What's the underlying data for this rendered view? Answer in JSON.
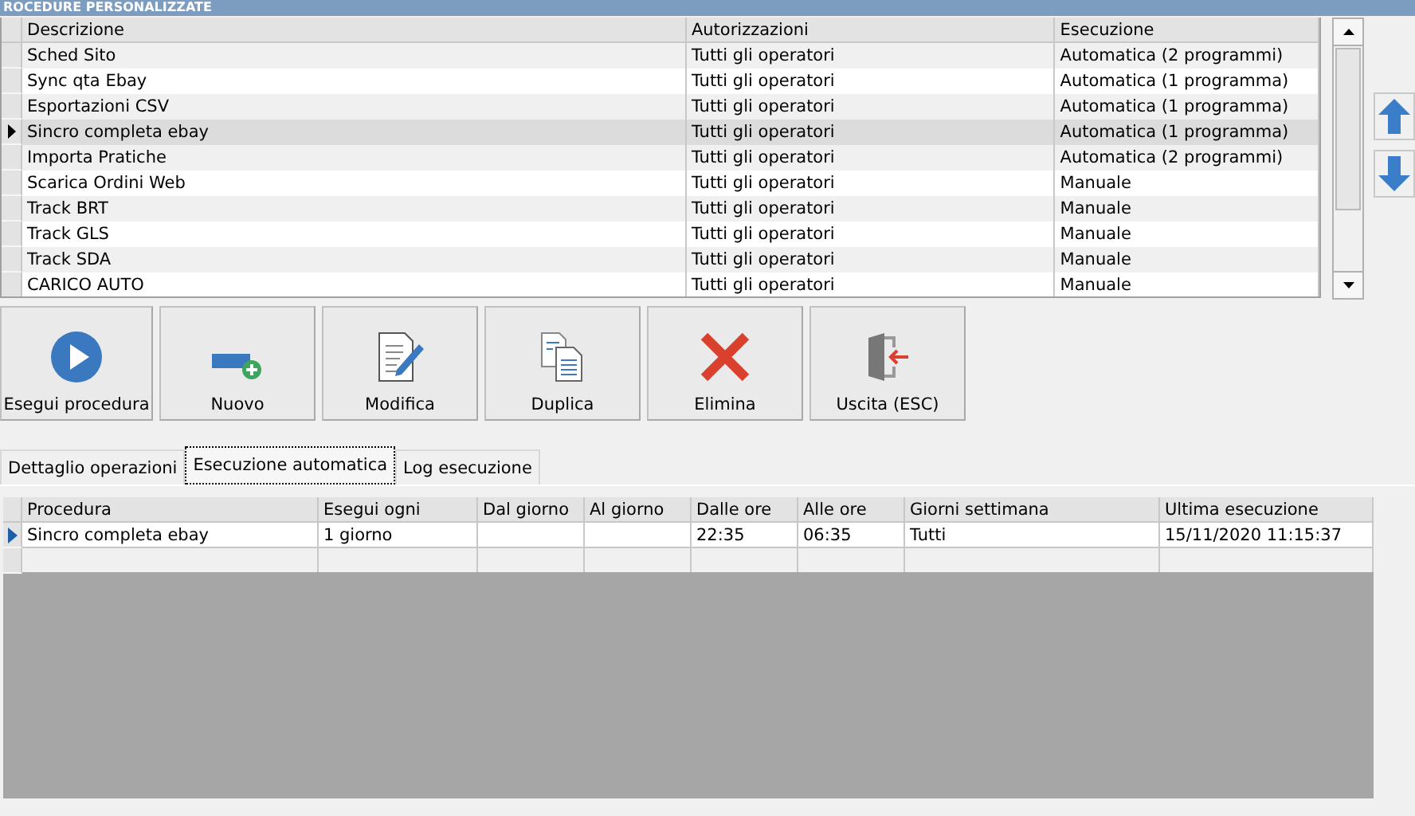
{
  "window": {
    "title": "ROCEDURE PERSONALIZZATE"
  },
  "procedures": {
    "columns": [
      "Descrizione",
      "Autorizzazioni",
      "Esecuzione"
    ],
    "rows": [
      {
        "cells": [
          "Sched Sito",
          "Tutti gli operatori",
          "Automatica (2 programmi)"
        ],
        "selected": false
      },
      {
        "cells": [
          "Sync qta Ebay",
          "Tutti gli operatori",
          "Automatica (1 programma)"
        ],
        "selected": false
      },
      {
        "cells": [
          "Esportazioni CSV",
          "Tutti gli operatori",
          "Automatica (1 programma)"
        ],
        "selected": false
      },
      {
        "cells": [
          "Sincro completa ebay",
          "Tutti gli operatori",
          "Automatica (1 programma)"
        ],
        "selected": true
      },
      {
        "cells": [
          "Importa Pratiche",
          "Tutti gli operatori",
          "Automatica (2 programmi)"
        ],
        "selected": false
      },
      {
        "cells": [
          "Scarica Ordini Web",
          "Tutti gli operatori",
          "Manuale"
        ],
        "selected": false
      },
      {
        "cells": [
          "Track BRT",
          "Tutti gli operatori",
          "Manuale"
        ],
        "selected": false
      },
      {
        "cells": [
          "Track GLS",
          "Tutti gli operatori",
          "Manuale"
        ],
        "selected": false
      },
      {
        "cells": [
          "Track SDA",
          "Tutti gli operatori",
          "Manuale"
        ],
        "selected": false
      },
      {
        "cells": [
          "CARICO AUTO",
          "Tutti gli operatori",
          "Manuale"
        ],
        "selected": false
      }
    ]
  },
  "toolbar": [
    {
      "kind": "play",
      "label": "Esegui procedura"
    },
    {
      "kind": "new",
      "label": "Nuovo"
    },
    {
      "kind": "edit",
      "label": "Modifica"
    },
    {
      "kind": "copy",
      "label": "Duplica"
    },
    {
      "kind": "delete",
      "label": "Elimina"
    },
    {
      "kind": "exit",
      "label": "Uscita (ESC)"
    }
  ],
  "tabs": [
    {
      "label": "Dettaglio operazioni",
      "selected": false
    },
    {
      "label": "Esecuzione automatica",
      "selected": true
    },
    {
      "label": "Log esecuzione",
      "selected": false
    }
  ],
  "schedule": {
    "columns": [
      "Procedura",
      "Esegui ogni",
      "Dal giorno",
      "Al giorno",
      "Dalle ore",
      "Alle ore",
      "Giorni settimana",
      "Ultima esecuzione"
    ],
    "rows": [
      {
        "cells": [
          "Sincro completa ebay",
          "1 giorno",
          "",
          "",
          "22:35",
          "06:35",
          "Tutti",
          "15/11/2020 11:15:37"
        ],
        "selected": true
      }
    ]
  }
}
